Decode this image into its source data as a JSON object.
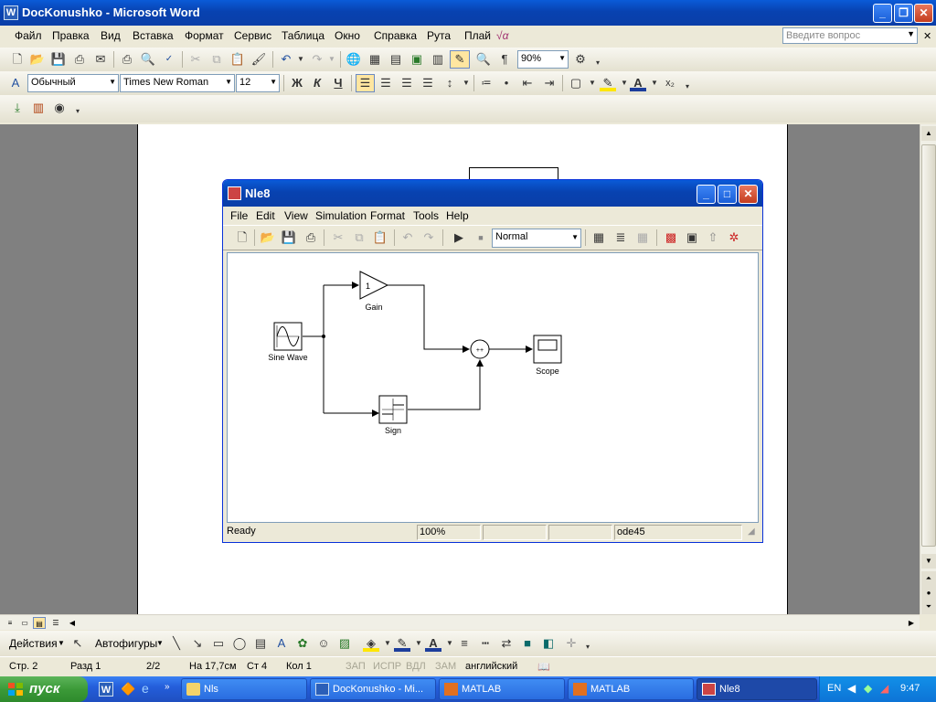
{
  "word": {
    "title": "DocKonushko - Microsoft Word",
    "menu": [
      "Файл",
      "Правка",
      "Вид",
      "Вставка",
      "Формат",
      "Сервис",
      "Таблица",
      "Окно",
      "Справка",
      "Рута",
      "Плай"
    ],
    "question_placeholder": "Введите вопрос",
    "zoom": "90%",
    "style": "Обычный",
    "font": "Times New Roman",
    "font_size": "12",
    "bold": "Ж",
    "italic": "К",
    "underline": "Ч",
    "draw_actions": "Действия",
    "autoshapes": "Автофигуры",
    "status": {
      "page": "Стр. 2",
      "section": "Разд 1",
      "pages": "2/2",
      "position": "На 17,7см",
      "line": "Ст 4",
      "col": "Кол 1",
      "rec": "ЗАП",
      "trk": "ИСПР",
      "ext": "ВДЛ",
      "ovr": "ЗАМ",
      "lang": "английский"
    }
  },
  "simulink": {
    "title": "Nle8",
    "menu": [
      "File",
      "Edit",
      "View",
      "Simulation",
      "Format",
      "Tools",
      "Help"
    ],
    "sim_mode": "Normal",
    "blocks": {
      "sine": "Sine Wave",
      "gain": "Gain",
      "gain_value": "1",
      "sign": "Sign",
      "scope": "Scope",
      "sum_signs": "++"
    },
    "status": {
      "state": "Ready",
      "zoom": "100%",
      "solver": "ode45"
    }
  },
  "taskbar": {
    "start": "пуск",
    "tasks": [
      "Nls",
      "DocKonushko - Mi...",
      "MATLAB",
      "MATLAB",
      "Nle8"
    ],
    "lang": "EN",
    "time": "9:47"
  }
}
